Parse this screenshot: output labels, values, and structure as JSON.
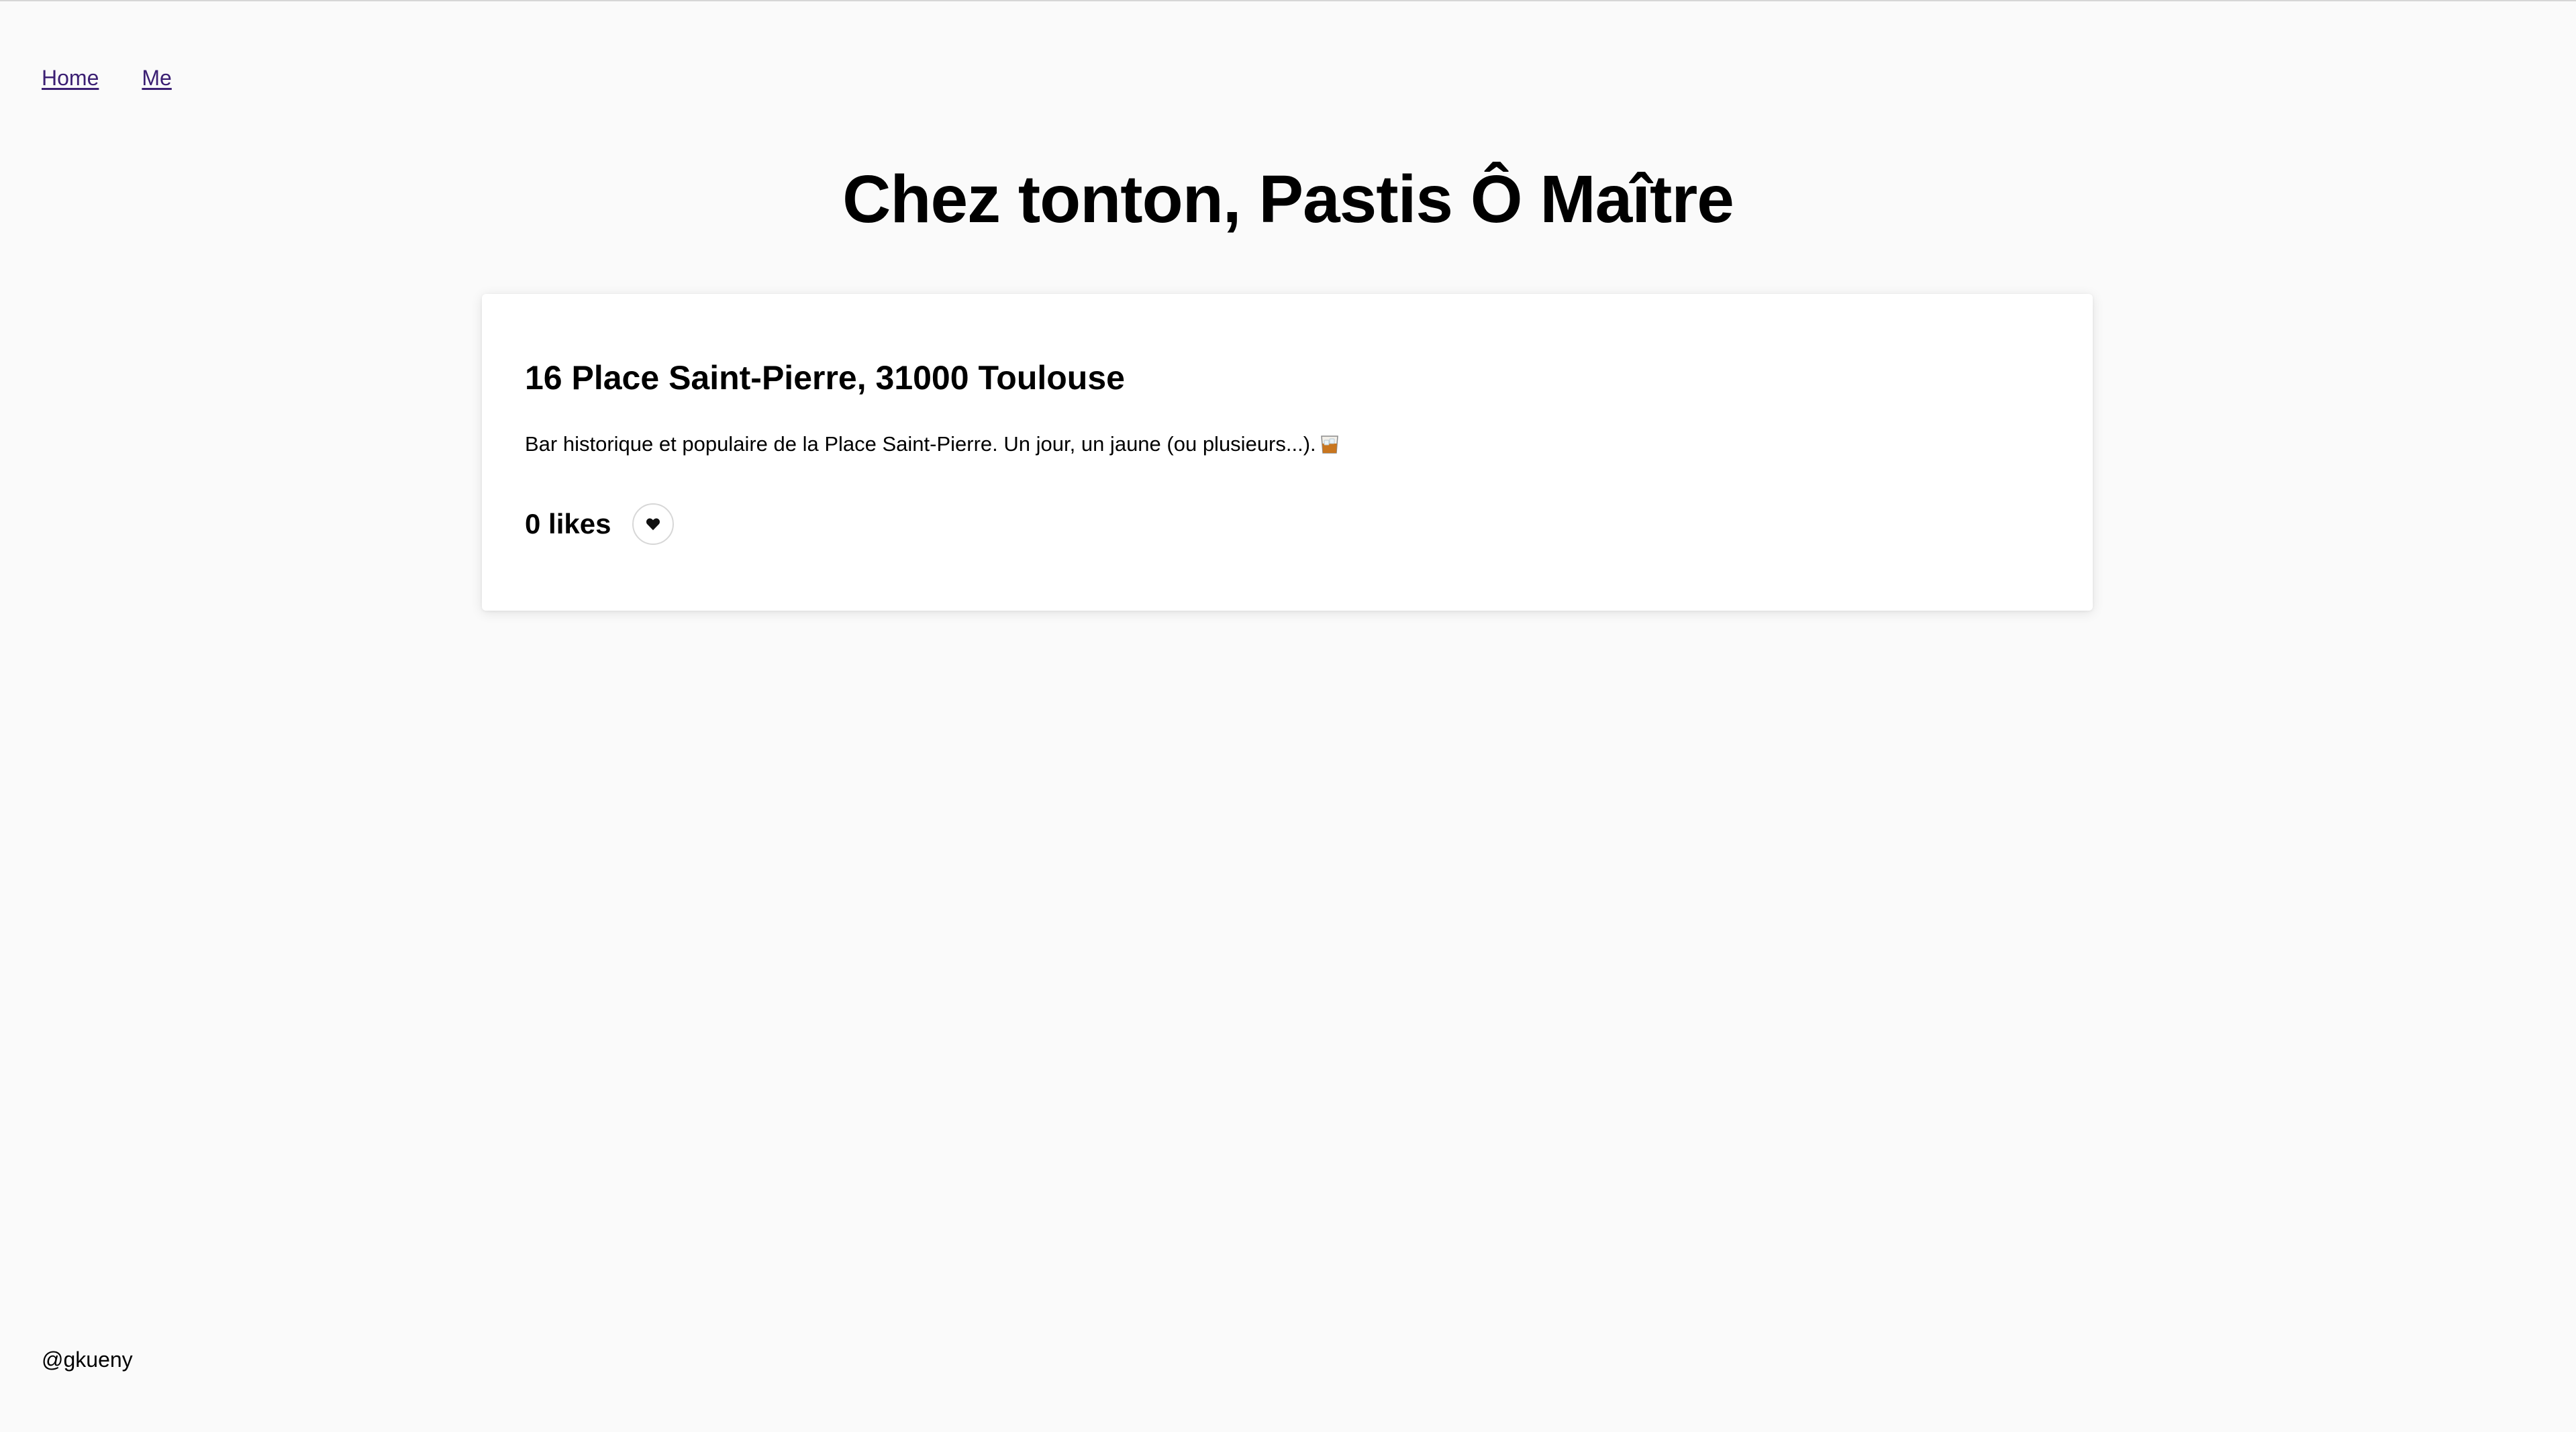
{
  "nav": {
    "home_label": "Home",
    "me_label": "Me"
  },
  "page": {
    "title": "Chez tonton, Pastis Ô Maître"
  },
  "place": {
    "address": "16 Place Saint-Pierre, 31000 Toulouse",
    "description": "Bar historique et populaire de la Place Saint-Pierre. Un jour, un jaune (ou plusieurs...).",
    "description_icon": "whisky-glass-icon",
    "likes_label": "0 likes",
    "like_icon": "heart-icon"
  },
  "footer": {
    "handle": "@gkueny"
  },
  "colors": {
    "background": "#fafafa",
    "card": "#ffffff",
    "link": "#3b1f73",
    "text": "#000000"
  }
}
